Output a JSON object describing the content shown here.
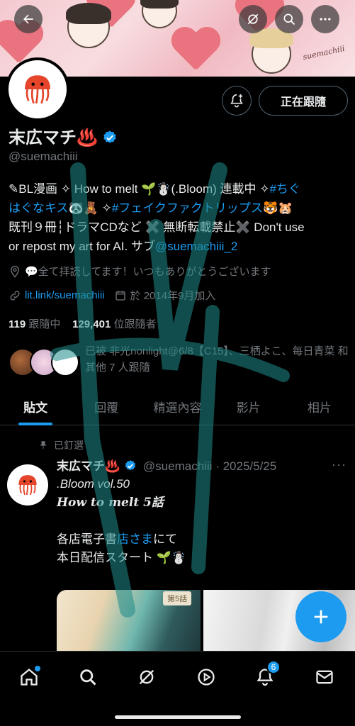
{
  "colors": {
    "accent": "#1d9bf0",
    "text": "#e7e9ea",
    "muted": "#71767b",
    "background": "#000000"
  },
  "banner": {
    "signature": "suemachiii"
  },
  "profile": {
    "name": "末広マチ♨️",
    "handle": "@suemachiii",
    "follow_button": "正在跟隨",
    "bio_line1_a": "✎BL漫画 ✧ How to melt 🌱☃️(.Bloom) 連載中 ✧",
    "bio_line1_link": "#ちぐ",
    "bio_line2_link": "はぐなキス",
    "bio_line2_a": "🐼🧸 ✧",
    "bio_line2_link2": "#フェイクファクトリップス",
    "bio_line2_b": "🐯🐹",
    "bio_line3": "既刊９冊┆ドラマCDなど ✖️ 無断転載禁止✖️ Don't use",
    "bio_line4_a": "or repost my art for AI. サブ",
    "bio_line4_link": "@suemachiii_2",
    "location": "💬全て拝読してます！いつもありがとうございます",
    "website": "lit.link/suemachiii",
    "joined": "於 2014年9月加入",
    "following_count": "119",
    "following_label": "跟隨中",
    "followers_count": "129,401",
    "followers_label": "位跟隨者",
    "followed_by": "已被 非光nonlight@6/8【C15】、三栖よこ、每日青菜 和其他 7 人跟隨"
  },
  "tabs": [
    {
      "label": "貼文"
    },
    {
      "label": "回覆"
    },
    {
      "label": "精選內容"
    },
    {
      "label": "影片"
    },
    {
      "label": "相片"
    }
  ],
  "post": {
    "pinned_label": "已釘選",
    "author": "末広マチ♨️",
    "handle_date": "@suemachiii · 2025/5/25",
    "more": "···",
    "line1": ".Bloom vol.50",
    "line2_a": "How to melt",
    "line2_b": " 5話",
    "line3_a": "各店電子書",
    "line3_link": "店さま",
    "line3_b": "にて",
    "line4": "本日配信スタート 🌱☃️",
    "media_badge": "第5話"
  },
  "nav": {
    "notifications_badge": "6",
    "icons": [
      "home-icon",
      "search-icon",
      "grok-icon",
      "video-icon",
      "bell-icon",
      "mail-icon"
    ]
  }
}
